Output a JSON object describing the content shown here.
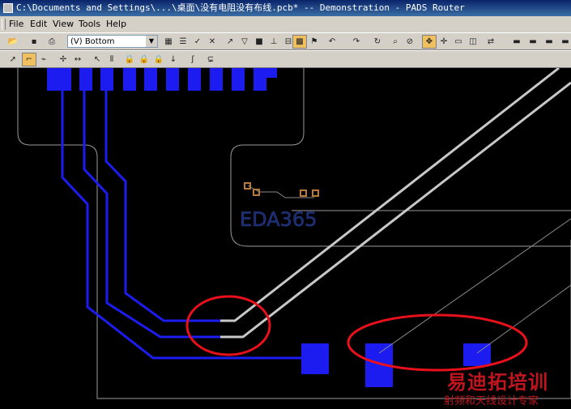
{
  "window": {
    "title": "C:\\Documents and Settings\\...\\桌面\\没有电阻没有布线.pcb* -- Demonstration - PADS Router"
  },
  "menu": [
    "File",
    "Edit",
    "View",
    "Tools",
    "Help"
  ],
  "layer_select": {
    "value": "(V) Bottom"
  },
  "board": {
    "silk_text": "EDA365"
  },
  "watermark": {
    "line1": "易迪拓培训",
    "line2": "射频和天线设计专家"
  },
  "colors": {
    "trace": "#1c1cf0",
    "diff_trace": "#c8c8c8",
    "highlight": "#e8101a",
    "outline": "#9a9a9a",
    "pad_small": "#b87a3a"
  }
}
